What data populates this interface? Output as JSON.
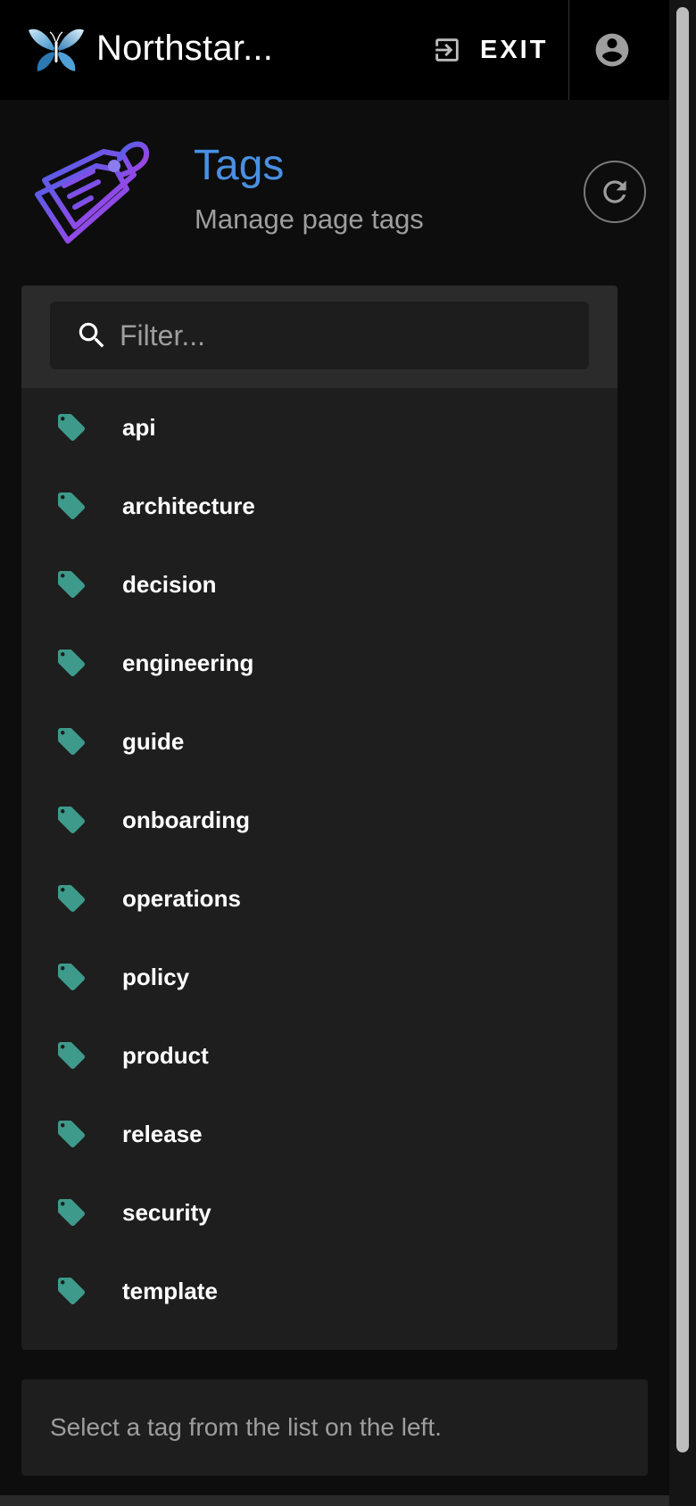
{
  "header": {
    "app_title": "Northstar...",
    "exit_label": "EXIT",
    "logo_icon": "butterfly-logo-icon",
    "exit_icon": "exit-icon",
    "account_icon": "account-circle-icon"
  },
  "page": {
    "title": "Tags",
    "subtitle": "Manage page tags",
    "icon": "tags-icon",
    "refresh_icon": "refresh-icon",
    "title_color": "#4a90e2"
  },
  "filter": {
    "placeholder": "Filter...",
    "value": "",
    "icon": "search-icon"
  },
  "tags": [
    {
      "label": "api"
    },
    {
      "label": "architecture"
    },
    {
      "label": "decision"
    },
    {
      "label": "engineering"
    },
    {
      "label": "guide"
    },
    {
      "label": "onboarding"
    },
    {
      "label": "operations"
    },
    {
      "label": "policy"
    },
    {
      "label": "product"
    },
    {
      "label": "release"
    },
    {
      "label": "security"
    },
    {
      "label": "template"
    }
  ],
  "tag_icon": "tag-icon",
  "tag_icon_color": "#3e9a8a",
  "detail": {
    "message": "Select a tag from the list on the left."
  }
}
